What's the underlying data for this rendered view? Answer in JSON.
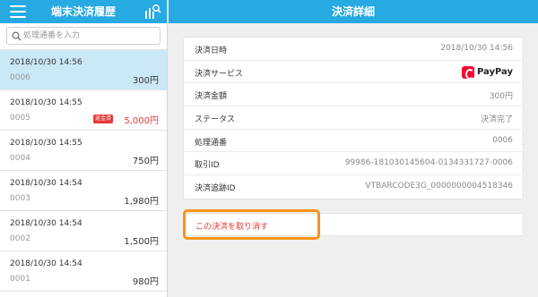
{
  "left": {
    "title": "端末決済履歴",
    "search_placeholder": "処理通番を入力",
    "items": [
      {
        "date": "2018/10/30 14:56",
        "number": "0006",
        "amount": "300円",
        "badge": "",
        "selected": true,
        "red": false
      },
      {
        "date": "2018/10/30 14:55",
        "number": "0005",
        "amount": "5,000円",
        "badge": "返金済",
        "selected": false,
        "red": true
      },
      {
        "date": "2018/10/30 14:55",
        "number": "0004",
        "amount": "750円",
        "badge": "",
        "selected": false,
        "red": false
      },
      {
        "date": "2018/10/30 14:54",
        "number": "0003",
        "amount": "1,980円",
        "badge": "",
        "selected": false,
        "red": false
      },
      {
        "date": "2018/10/30 14:54",
        "number": "0002",
        "amount": "1,500円",
        "badge": "",
        "selected": false,
        "red": false
      },
      {
        "date": "2018/10/30 14:54",
        "number": "0001",
        "amount": "980円",
        "badge": "",
        "selected": false,
        "red": false
      }
    ]
  },
  "right": {
    "title": "決済詳細",
    "rows": [
      {
        "label": "決済日時",
        "value": "2018/10/30 14:56"
      },
      {
        "label": "決済サービス",
        "value": "PayPay",
        "logo": true
      },
      {
        "label": "決済金額",
        "value": "300円"
      },
      {
        "label": "ステータス",
        "value": "決済完了"
      },
      {
        "label": "処理通番",
        "value": "0006"
      },
      {
        "label": "取引ID",
        "value": "99986-181030145604-0134331727-0006"
      },
      {
        "label": "決済追跡ID",
        "value": "VTBARCODE3G_0000000004518346"
      }
    ],
    "cancel_label": "この決済を取り消す"
  },
  "colors": {
    "header": "#27a9e1",
    "selected_row": "#cbe8f7",
    "danger": "#e53935",
    "highlight": "#f7941d",
    "paypay": "#ff0033"
  }
}
